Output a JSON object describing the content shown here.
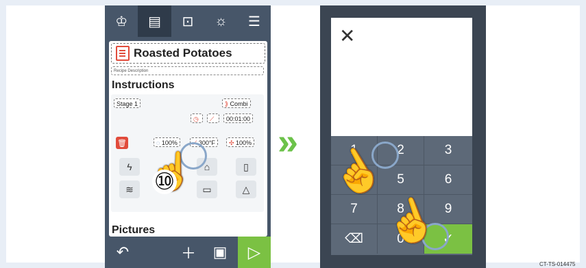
{
  "left_screen": {
    "topbar_icons": [
      "chef-hat-icon",
      "recipe-doc-icon",
      "lock-icon",
      "brightness-icon",
      "menu-icon"
    ],
    "recipe_title": "Roasted Potatoes",
    "description_placeholder": "Recipe Description",
    "instructions_heading": "Instructions",
    "stage_label": "Stage 1",
    "mode_label": "Combi",
    "time_value": "00:01:00",
    "humidity": "100%",
    "temperature": "300°F",
    "fan": "100%",
    "step_number": "⑩",
    "pictures_heading": "Pictures"
  },
  "right_screen": {
    "keys": [
      "1",
      "2",
      "3",
      "4",
      "5",
      "6",
      "7",
      "8",
      "9",
      "⌫",
      "0",
      "✓"
    ]
  },
  "arrow": "»",
  "doc_code": "CT-TS-014475"
}
